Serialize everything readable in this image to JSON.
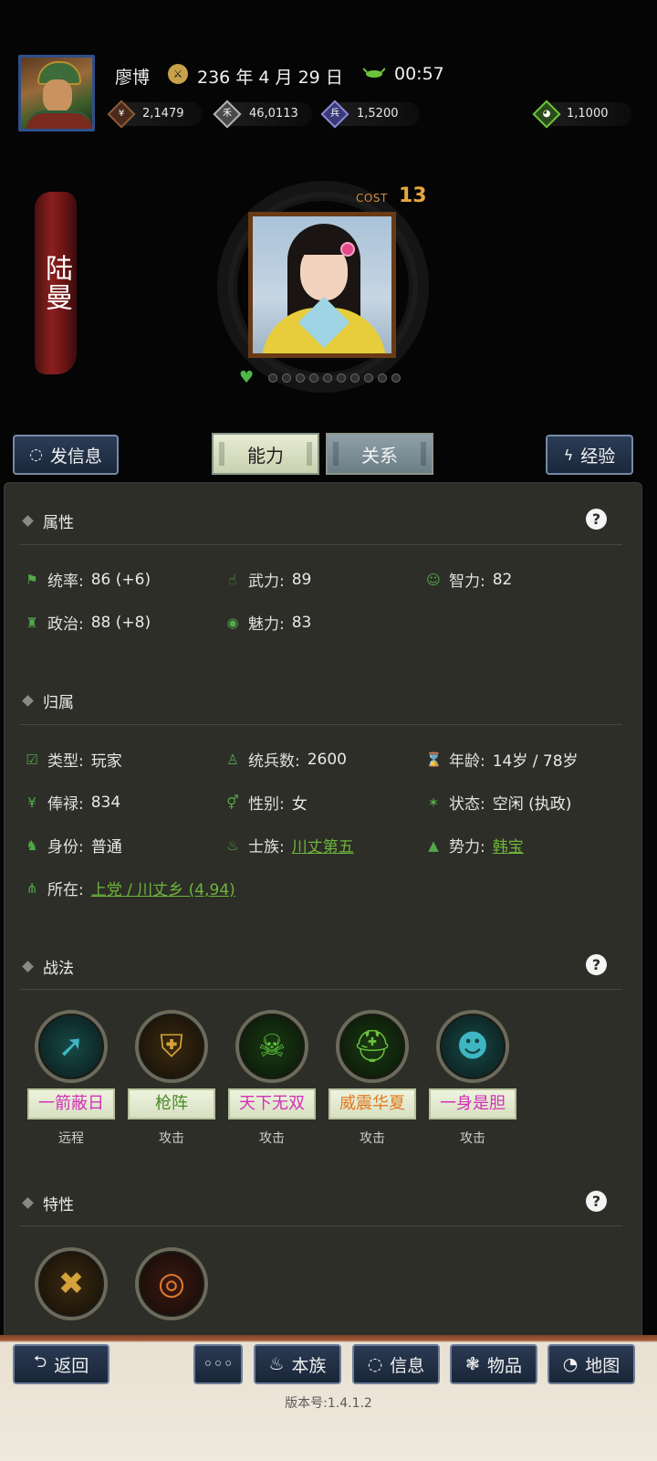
{
  "header": {
    "player_name": "廖博",
    "year": "236",
    "year_unit": "年",
    "month": "4",
    "month_unit": "月",
    "day": "29",
    "day_unit": "日",
    "time": "00:57",
    "resources": [
      {
        "icon": "money-icon",
        "value": "2,1479"
      },
      {
        "icon": "grain-icon",
        "value": "46,0113"
      },
      {
        "icon": "troops-icon",
        "value": "1,5200"
      },
      {
        "icon": "gourd-icon",
        "value": "1,1000"
      }
    ]
  },
  "character": {
    "name": "陆曼",
    "cost_label": "COST",
    "cost_value": "13"
  },
  "actions": {
    "send_message": "发信息",
    "tab_ability": "能力",
    "tab_relation": "关系",
    "experience": "经验"
  },
  "attributes": {
    "title": "属性",
    "stats": [
      {
        "icon": "flag-icon",
        "label": "统率:",
        "value": "86 (+6)"
      },
      {
        "icon": "strength-icon",
        "label": "武力:",
        "value": "89"
      },
      {
        "icon": "brain-icon",
        "label": "智力:",
        "value": "82"
      },
      {
        "icon": "politics-icon",
        "label": "政治:",
        "value": "88 (+8)"
      },
      {
        "icon": "eye-icon",
        "label": "魅力:",
        "value": "83"
      }
    ]
  },
  "affiliation": {
    "title": "归属",
    "type_label": "类型:",
    "type_value": "玩家",
    "troops_label": "统兵数:",
    "troops_value": "2600",
    "age_label": "年龄:",
    "age_value": "14岁 / 78岁",
    "salary_label": "俸禄:",
    "salary_value": "834",
    "gender_label": "性别:",
    "gender_value": "女",
    "status_label": "状态:",
    "status_value": "空闲 (执政)",
    "identity_label": "身份:",
    "identity_value": "普通",
    "clan_label": "士族:",
    "clan_value": "川丈第五",
    "faction_label": "势力:",
    "faction_value": "韩宝",
    "location_label": "所在:",
    "location_value": "上党 / 川丈乡 (4,94)"
  },
  "tactics": {
    "title": "战法",
    "items": [
      {
        "name": "一箭蔽日",
        "type": "远程",
        "color": "#d430b8"
      },
      {
        "name": "枪阵",
        "type": "攻击",
        "color": "#4a8a2a"
      },
      {
        "name": "天下无双",
        "type": "攻击",
        "color": "#d430b8"
      },
      {
        "name": "威震华夏",
        "type": "攻击",
        "color": "#e07a20"
      },
      {
        "name": "一身是胆",
        "type": "攻击",
        "color": "#d430b8"
      }
    ]
  },
  "traits": {
    "title": "特性"
  },
  "nav": {
    "back": "返回",
    "more": "◦◦◦",
    "clan": "本族",
    "info": "信息",
    "items": "物品",
    "map": "地图"
  },
  "version": "版本号:1.4.1.2",
  "colors": {
    "panel_bg": "#2d2e28",
    "link_green": "#6db53a",
    "icon_green": "#52a84a",
    "cost_orange": "#e7a63f",
    "button_blue": "#1b283b"
  }
}
